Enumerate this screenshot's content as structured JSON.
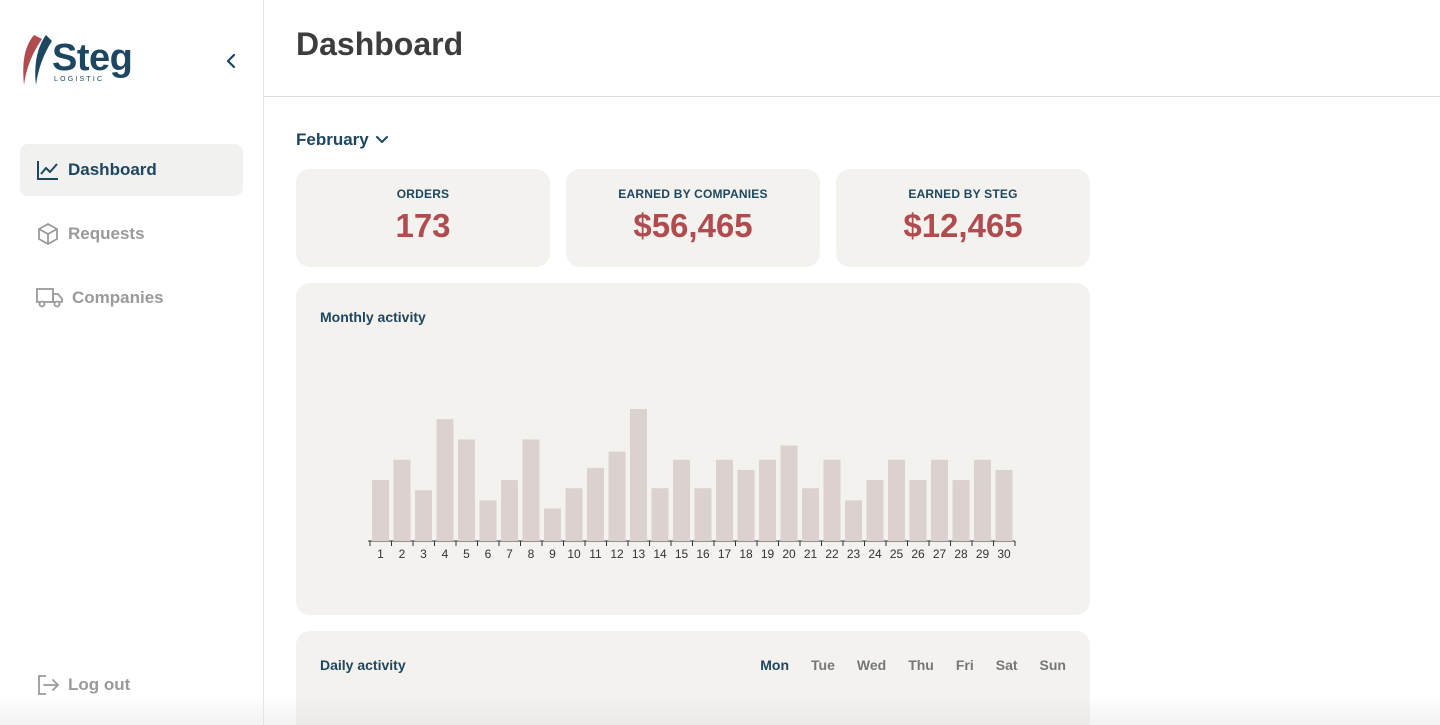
{
  "brand": {
    "name": "Steg",
    "tagline": "LOGISTIC",
    "primary_color": "#1d4660",
    "accent_color": "#b04b4f"
  },
  "sidebar": {
    "items": [
      {
        "label": "Dashboard",
        "icon": "chart-line-icon",
        "active": true
      },
      {
        "label": "Requests",
        "icon": "box-icon",
        "active": false
      },
      {
        "label": "Companies",
        "icon": "truck-icon",
        "active": false
      }
    ],
    "logout_label": "Log out"
  },
  "header": {
    "title": "Dashboard"
  },
  "filters": {
    "month": "February"
  },
  "stats": [
    {
      "label": "ORDERS",
      "value": "173"
    },
    {
      "label": "EARNED BY COMPANIES",
      "value": "$56,465"
    },
    {
      "label": "EARNED BY STEG",
      "value": "$12,465"
    }
  ],
  "monthly_activity": {
    "title": "Monthly activity"
  },
  "daily_activity": {
    "title": "Daily activity",
    "days": [
      "Mon",
      "Tue",
      "Wed",
      "Thu",
      "Fri",
      "Sat",
      "Sun"
    ],
    "selected": "Mon"
  },
  "chart_data": {
    "type": "bar",
    "title": "Monthly activity",
    "categories": [
      "1",
      "2",
      "3",
      "4",
      "5",
      "6",
      "7",
      "8",
      "9",
      "10",
      "11",
      "12",
      "13",
      "14",
      "15",
      "16",
      "17",
      "18",
      "19",
      "20",
      "21",
      "22",
      "23",
      "24",
      "25",
      "26",
      "27",
      "28",
      "29",
      "30"
    ],
    "values": [
      30,
      40,
      25,
      60,
      50,
      20,
      30,
      50,
      16,
      26,
      36,
      44,
      65,
      26,
      40,
      26,
      40,
      35,
      40,
      47,
      26,
      40,
      20,
      30,
      40,
      30,
      40,
      30,
      40,
      35
    ],
    "xlabel": "",
    "ylabel": "",
    "bar_color": "#dbd1cf",
    "grid": false
  }
}
